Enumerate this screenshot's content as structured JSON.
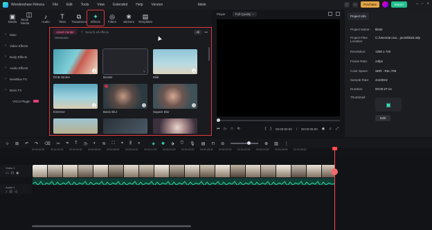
{
  "titlebar": {
    "app_name": "Wondershare Filmora",
    "menu": [
      "File",
      "Edit",
      "Tools",
      "View",
      "Extended",
      "Help",
      "Version"
    ],
    "doc_title": "tiktok",
    "purchase": "Purchase",
    "export": "Export"
  },
  "toolbar": {
    "items": [
      {
        "label": "Media",
        "icon": "media-icon",
        "glyph": "▣"
      },
      {
        "label": "Stock Media",
        "icon": "stock-media-icon",
        "glyph": "◫"
      },
      {
        "label": "Audio",
        "icon": "audio-icon",
        "glyph": "♪"
      },
      {
        "label": "Titles",
        "icon": "titles-icon",
        "glyph": "T"
      },
      {
        "label": "Transitions",
        "icon": "transitions-icon",
        "glyph": "⧉"
      },
      {
        "label": "Effects",
        "icon": "effects-icon",
        "glyph": "✦",
        "active": true
      },
      {
        "label": "Filters",
        "icon": "filters-icon",
        "glyph": "◎"
      },
      {
        "label": "Stickers",
        "icon": "stickers-icon",
        "glyph": "❀"
      },
      {
        "label": "Templates",
        "icon": "templates-icon",
        "glyph": "▤"
      }
    ]
  },
  "categories": [
    "Mine",
    "Video Effects",
    "Body Effects",
    "Audio Effects",
    "NewBlue FX",
    "Boris FX",
    "VSC3 Plugin"
  ],
  "effects_panel": {
    "asset_center": "Asset Center",
    "search_placeholder": "Search all effects",
    "filter": "All",
    "section": "TRENDING",
    "cards": [
      {
        "label": "RGB Stroke"
      },
      {
        "label": "Border"
      },
      {
        "label": "Mild"
      },
      {
        "label": "Extreme"
      },
      {
        "label": "Basic Blur"
      },
      {
        "label": "Square Blur"
      },
      {
        "label": ""
      },
      {
        "label": ""
      },
      {
        "label": ""
      }
    ]
  },
  "player": {
    "label": "Player",
    "quality": "Full Quality",
    "time_current": "00:00:00:00",
    "time_total": "00:00:05:00"
  },
  "project_info": {
    "tab": "Project Info",
    "rows": [
      {
        "k": "Project Name:",
        "v": "tiktok"
      },
      {
        "k": "Project Files Location:",
        "v": "C:/Users/an.iva....jects/tiktok.wfp"
      },
      {
        "k": "Resolution:",
        "v": "1280 x 720"
      },
      {
        "k": "Frame Rate:",
        "v": "24fps"
      },
      {
        "k": "Color Space:",
        "v": "SDR - Rec.709"
      },
      {
        "k": "Sample Rate:",
        "v": "44100Hz"
      },
      {
        "k": "Duration:",
        "v": "00:00:27:14"
      },
      {
        "k": "Thumbnail:",
        "v": ""
      }
    ],
    "edit": "Edit"
  },
  "timeline": {
    "ruler": [
      "00:00:00:00",
      "00:00:02:00",
      "00:00:04:00",
      "00:00:06:00",
      "00:00:08:00",
      "00:00:10:00",
      "00:00:12:00",
      "00:00:14:00",
      "00:00:16:00",
      "00:00:18:00",
      "00:00:20:00",
      "00:00:22:00",
      "00:00:24:00",
      "00:00:26:00",
      "00:00:28:00"
    ],
    "video_track": "Video 1",
    "audio_track": "Audio 1"
  }
}
